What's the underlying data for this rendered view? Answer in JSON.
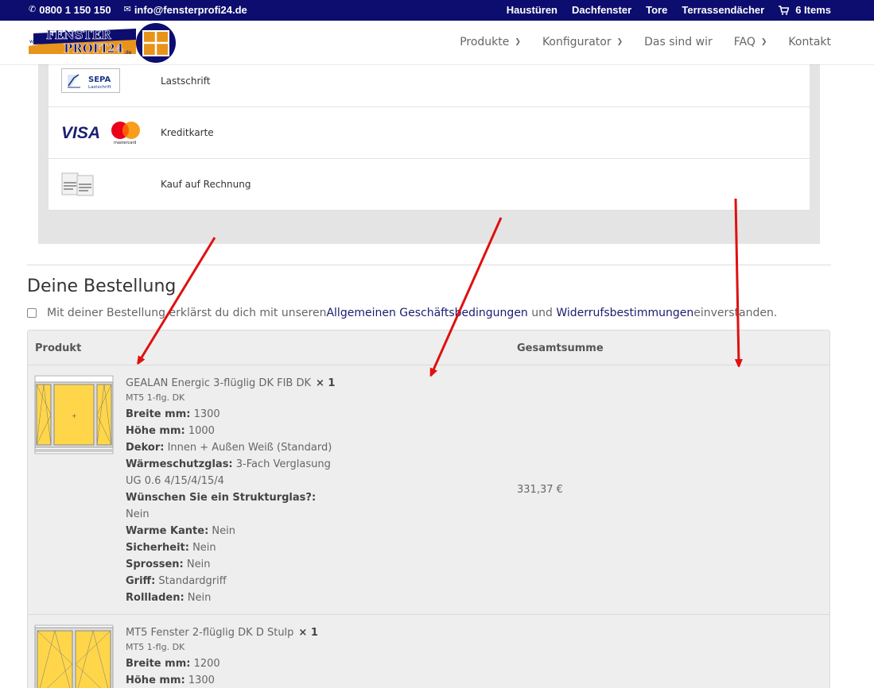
{
  "topbar": {
    "phone": "0800 1 150 150",
    "email": "info@fensterprofi24.de",
    "links": [
      "Haustüren",
      "Dachfenster",
      "Tore",
      "Terrassendächer"
    ],
    "cart_label": "6 Items"
  },
  "logo": {
    "www": "www.",
    "line1": "FENSTER",
    "line2": "PROFI24",
    "tld": ".de"
  },
  "nav": {
    "items": [
      {
        "label": "Produkte",
        "has_dropdown": true
      },
      {
        "label": "Konfigurator",
        "has_dropdown": true
      },
      {
        "label": "Das sind wir",
        "has_dropdown": false
      },
      {
        "label": "FAQ",
        "has_dropdown": true
      },
      {
        "label": "Kontakt",
        "has_dropdown": false
      }
    ]
  },
  "payment": {
    "methods": [
      {
        "label": "Lastschrift",
        "icon_text": "SEPA",
        "icon_sub": "Lastschrift",
        "icon": "sepa-logo"
      },
      {
        "label": "Kreditkarte",
        "icon_text": "VISA",
        "icon_sub": "mastercard",
        "icon": "visa-mastercard-logo"
      },
      {
        "label": "Kauf auf Rechnung",
        "icon": "invoice-icon"
      }
    ]
  },
  "order": {
    "title": "Deine Bestellung",
    "terms": {
      "prefix": "Mit deiner Bestellung erklärst du dich mit unseren ",
      "agb": "Allgemeinen Geschäftsbedingungen",
      "middle": " und ",
      "widerruf": "Widerrufsbestimmungen",
      "suffix": " einverstanden."
    },
    "table": {
      "col_product": "Produkt",
      "col_total": "Gesamtsumme",
      "rows": [
        {
          "name": "GEALAN Energic 3-flüglig DK FIB DK",
          "qty": "× 1",
          "sub": "MT5 1-flg. DK",
          "total": "331,37 €",
          "attrs": [
            {
              "k": "Breite mm:",
              "v": " 1300"
            },
            {
              "k": "Höhe mm:",
              "v": " 1000"
            },
            {
              "k": "Dekor:",
              "v": " Innen + Außen Weiß (Standard)"
            },
            {
              "k": "Wärmeschutzglas:",
              "v": " 3-Fach Verglasung"
            },
            {
              "k": "",
              "v": "UG 0.6 4/15/4/15/4"
            },
            {
              "k": "Wünschen Sie ein Strukturglas?:",
              "v": ""
            },
            {
              "k": "",
              "v": "Nein"
            },
            {
              "k": "Warme Kante:",
              "v": " Nein"
            },
            {
              "k": "Sicherheit:",
              "v": " Nein"
            },
            {
              "k": "Sprossen:",
              "v": " Nein"
            },
            {
              "k": "Griff:",
              "v": " Standardgriff"
            },
            {
              "k": "Rollladen:",
              "v": " Nein"
            }
          ]
        },
        {
          "name": "MT5 Fenster 2-flüglig DK D Stulp",
          "qty": "× 1",
          "sub": "MT5 1-flg. DK",
          "attrs": [
            {
              "k": "Breite mm:",
              "v": " 1200"
            },
            {
              "k": "Höhe mm:",
              "v": " 1300"
            }
          ]
        }
      ]
    }
  },
  "colors": {
    "topbar_bg": "#0c0d6e",
    "link": "#1b1c6e",
    "window_glass": "#ffd64a",
    "arrow": "#e01010"
  }
}
